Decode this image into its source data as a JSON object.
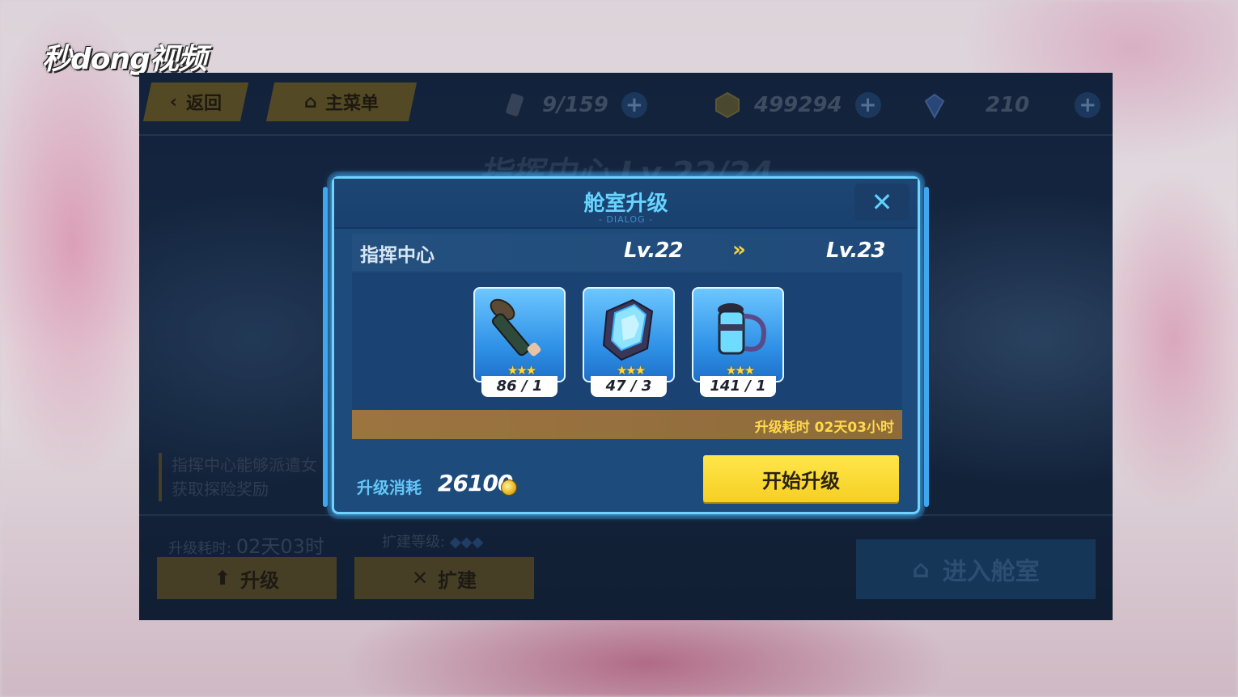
{
  "watermark": "秒dong视频",
  "topbar": {
    "back_label": "返回",
    "menu_label": "主菜单",
    "resources": [
      {
        "icon": "stamina-icon",
        "value": "9/159"
      },
      {
        "icon": "coin-icon",
        "value": "499294"
      },
      {
        "icon": "crystal-icon",
        "value": "210"
      }
    ]
  },
  "background": {
    "room_title": "指挥中心 Lv.22/24",
    "description": "指挥中心能够派遣女\n获取探险奖励",
    "upgrade_time_label": "升级耗时:",
    "upgrade_time_value": "02天03时",
    "expand_level_label": "扩建等级:",
    "upgrade_button": "升级",
    "expand_button": "扩建",
    "enter_button": "进入舱室"
  },
  "dialog": {
    "title": "舱室升级",
    "subtitle": "- DIALOG -",
    "room_name": "指挥中心",
    "level_from": "Lv.22",
    "level_to": "Lv.23",
    "materials": [
      {
        "icon": "katana-hilt-icon",
        "stars": 3,
        "count": "86 / 1"
      },
      {
        "icon": "energy-crystal-icon",
        "stars": 3,
        "count": "47 / 3"
      },
      {
        "icon": "coolant-canister-icon",
        "stars": 3,
        "count": "141 / 1"
      }
    ],
    "time_text": "升级耗时  02天03小时",
    "cost_label": "升级消耗",
    "cost_value": "26100",
    "start_button": "开始升级"
  },
  "colors": {
    "accent": "#66d4ff",
    "button_yellow": "#f6cf23",
    "time_bar": "#9c7440"
  }
}
